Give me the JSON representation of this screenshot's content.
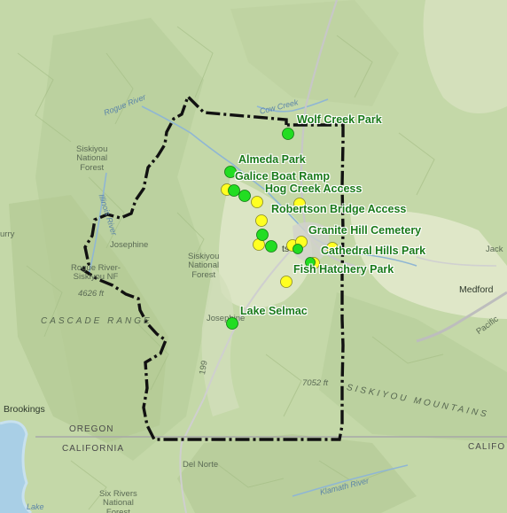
{
  "map": {
    "parks": [
      {
        "label": "Wolf Creek Park",
        "color": "#22dd22"
      },
      {
        "label": "Almeda Park",
        "color": "#22dd22"
      },
      {
        "label": "Galice Boat Ramp",
        "color": "#22dd22"
      },
      {
        "label": "Hog Creek Access",
        "color": "#22dd22"
      },
      {
        "label": "Robertson Bridge Access",
        "color": "#22dd22"
      },
      {
        "label": "Granite Hill Cemetery",
        "color": "#22dd22"
      },
      {
        "label": "Cathedral Hills Park",
        "color": "#22dd22"
      },
      {
        "label": "Fish Hatchery Park",
        "color": "#22dd22"
      },
      {
        "label": "Lake Selmac",
        "color": "#22dd22"
      }
    ],
    "marker_colors": {
      "green": "#22dd22",
      "yellow": "#ffff22",
      "boundary": "#111111"
    },
    "basemap_labels": {
      "siskiyou_nf_1": "Siskiyou\nNational\nForest",
      "siskiyou_nf_2": "Siskiyou\nNational\nForest",
      "six_rivers_nf": "Six Rivers\nNational\nForest",
      "josephine_1": "Josephine",
      "josephine_2": "Josephine",
      "rogue_river_nf": "Rogue River-\nSiskiyou NF",
      "cascade_range": "CASCADE RANGE",
      "siskiyou_mountains": "SISKIYOU MOUNTAINS",
      "elev_4626": "4626 ft",
      "elev_7052": "7052 ft",
      "medford": "Medford",
      "brookings": "Brookings",
      "oregon": "OREGON",
      "california_left": "CALIFORNIA",
      "california_right": "CALIFO",
      "del_norte": "Del Norte",
      "jack": "Jack",
      "curry": "urry",
      "rogue_river": "Rogue River",
      "cow_creek": "Cow Creek",
      "illinois_river": "Illinois River",
      "klamath_river": "Klamath River",
      "pacific": "Pacific",
      "lake": "Lake",
      "highway_199": "199",
      "pass_city": "ts"
    }
  }
}
